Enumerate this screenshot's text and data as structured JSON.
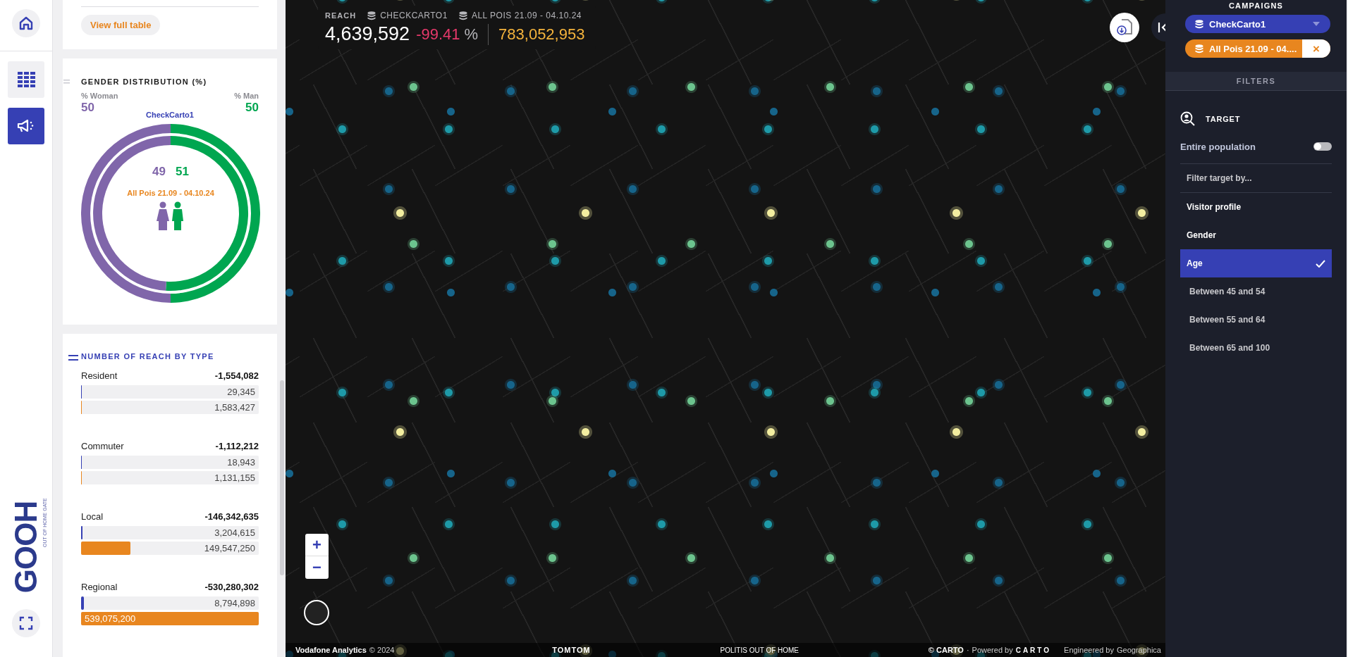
{
  "rail": {
    "home": {
      "selected": false
    },
    "nav": [
      {
        "kind": "grid",
        "selected": false
      },
      {
        "kind": "campaign",
        "selected": true
      }
    ],
    "logo": {
      "text": "GOOH",
      "tagline": "OUT OF HOME GATE"
    }
  },
  "table_card": {
    "button": "View full table"
  },
  "gender": {
    "title": "GENDER DISTRIBUTION (%)",
    "legend_values": [
      "50",
      "50"
    ],
    "inner_values": [
      "49",
      "51"
    ],
    "chart_data": {
      "type": "donut",
      "categories": [
        "% Woman",
        "% Man"
      ],
      "series": [
        {
          "name": "CheckCarto1",
          "colors": [
            "#8066aa",
            "#00a650"
          ],
          "values": [
            50,
            50
          ]
        },
        {
          "name": "All Pois 21.09 - 04.10.24",
          "colors": [
            "#8066aa",
            "#00a650"
          ],
          "values": [
            49,
            51
          ]
        }
      ]
    }
  },
  "reach_by_type": {
    "title": "NUMBER OF REACH BY TYPE",
    "rows": [
      {
        "label": "Resident",
        "difference": "-1,554,082",
        "bars": [
          {
            "value": "29,345",
            "level": 0.0001
          },
          {
            "value": "1,583,427",
            "level": 0.003
          }
        ]
      },
      {
        "label": "Commuter",
        "difference": "-1,112,212",
        "bars": [
          {
            "value": "18,943",
            "level": 0.0001
          },
          {
            "value": "1,131,155",
            "level": 0.002
          }
        ]
      },
      {
        "label": "Local",
        "difference": "-146,342,635",
        "bars": [
          {
            "value": "3,204,615",
            "level": 0.006
          },
          {
            "value": "149,547,250",
            "level": 0.277
          }
        ]
      },
      {
        "label": "Regional",
        "difference": "-530,280,302",
        "bars": [
          {
            "value": "8,794,898",
            "level": 0.016
          },
          {
            "value": "539,075,200",
            "level": 1.0
          }
        ]
      }
    ]
  },
  "map_header": {
    "label": "REACH",
    "campaigns": [
      "CHECKCARTO1",
      "ALL POIS 21.09 - 04.10.24"
    ],
    "value": "4,639,592",
    "change": "-99.41",
    "unit": "%",
    "compare_value": "783,052,953"
  },
  "map_controls": {
    "zoom_in": "+",
    "zoom_out": "−"
  },
  "attribution": {
    "left_credit": "Vodafone Analytics",
    "left_year": "© 2024",
    "logo_1": "TOMTOM",
    "center_credit": "POLITIS OUT OF HOME",
    "right_credit": "© CARTO",
    "separator": "·",
    "powered_label": "Powered by",
    "logo_2": "CARTO",
    "engineered_label": "Engineered by",
    "engineered_name": "Geographica"
  },
  "campaigns": {
    "title": "CAMPAIGNS",
    "items": [
      {
        "label": "CheckCarto1",
        "kind": "primary"
      },
      {
        "label": "All Pois 21.09 - 04....",
        "kind": "compare",
        "remove": "×"
      }
    ]
  },
  "filters": {
    "title": "FILTERS",
    "target": "TARGET",
    "entire_population": {
      "label": "Entire population",
      "on": false
    },
    "placeholder": "Filter target by...",
    "items": [
      {
        "label": "Visitor profile",
        "selected": false
      },
      {
        "label": "Gender",
        "selected": false
      },
      {
        "label": "Age",
        "selected": true,
        "children": [
          {
            "label": "Between 45 and 54",
            "selected": false
          },
          {
            "label": "Between 55 and 64",
            "selected": false
          },
          {
            "label": "Between 65 and 100",
            "selected": false
          }
        ]
      }
    ]
  }
}
